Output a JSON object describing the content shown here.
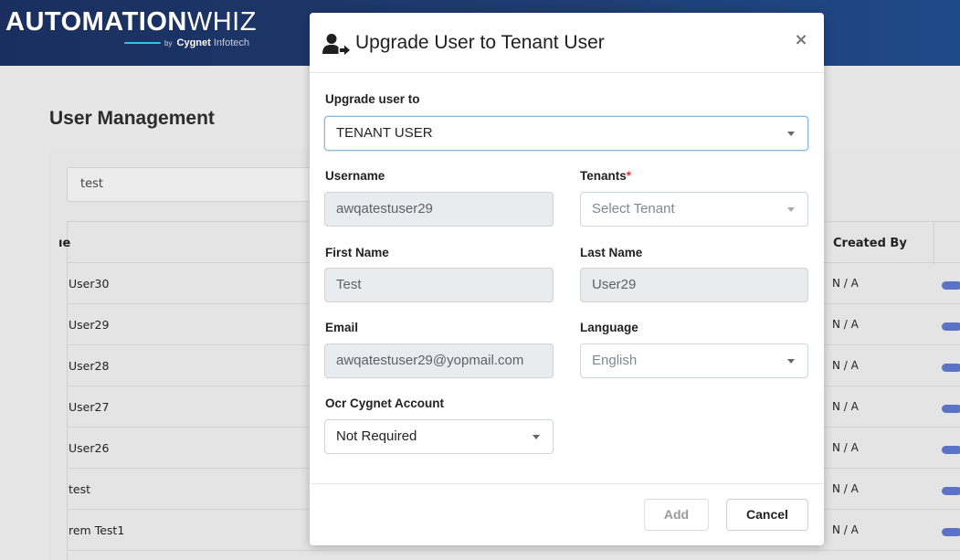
{
  "brand": {
    "name_bold": "AUTOMATION",
    "name_light": "WHIZ",
    "by": "by",
    "company_bold": "Cygnet",
    "company_light": "Infotech"
  },
  "page": {
    "title": "User Management",
    "search_value": "test"
  },
  "table": {
    "headers": {
      "name": "ıe",
      "created_by": "Created By"
    },
    "rows": [
      {
        "name": "User30",
        "created_by": "N / A"
      },
      {
        "name": "User29",
        "created_by": "N / A"
      },
      {
        "name": "User28",
        "created_by": "N / A"
      },
      {
        "name": "User27",
        "created_by": "N / A"
      },
      {
        "name": "User26",
        "created_by": "N / A"
      },
      {
        "name": "test",
        "created_by": "N / A"
      },
      {
        "name": "rem Test1",
        "created_by": "N / A"
      }
    ]
  },
  "modal": {
    "title": "Upgrade User to Tenant User",
    "icon": "user-arrow-icon",
    "close_glyph": "×",
    "fields": {
      "upgrade_to": {
        "label": "Upgrade user to",
        "value": "TENANT USER"
      },
      "username": {
        "label": "Username",
        "value": "awqatestuser29"
      },
      "tenants": {
        "label": "Tenants",
        "required_mark": "*",
        "placeholder": "Select Tenant"
      },
      "first_name": {
        "label": "First Name",
        "value": "Test"
      },
      "last_name": {
        "label": "Last Name",
        "value": "User29"
      },
      "email": {
        "label": "Email",
        "value": "awqatestuser29@yopmail.com"
      },
      "language": {
        "label": "Language",
        "value": "English"
      },
      "ocr": {
        "label": "Ocr Cygnet Account",
        "value": "Not Required"
      }
    },
    "buttons": {
      "add": "Add",
      "cancel": "Cancel"
    }
  },
  "colors": {
    "header_bg": "#1e3c72",
    "toggle": "#5b73c7",
    "required": "#e0353b"
  }
}
